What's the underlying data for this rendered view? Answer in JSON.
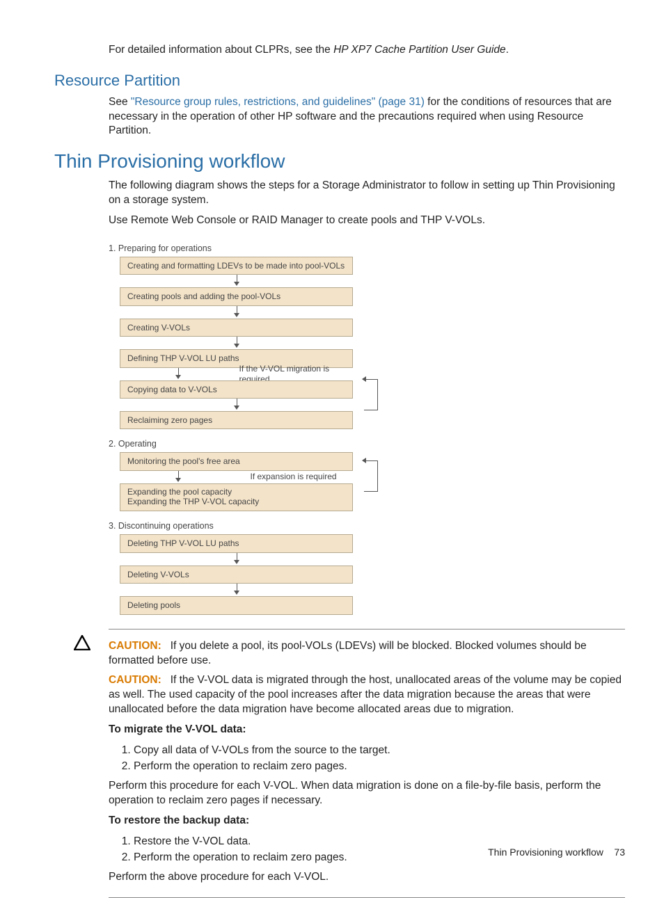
{
  "intro_para": {
    "pre": "For detailed information about CLPRs, see the ",
    "italic": "HP XP7 Cache Partition User Guide",
    "post": "."
  },
  "h_resource": "Resource Partition",
  "resource_para": {
    "pre": "See ",
    "link": "\"Resource group rules, restrictions, and guidelines\" (page 31)",
    "post": " for the conditions of resources that are necessary in the operation of other HP software and the precautions required when using Resource Partition."
  },
  "h_workflow": "Thin Provisioning workflow",
  "workflow_p1": "The following diagram shows the steps for a Storage Administrator to follow in setting up Thin Provisioning on a storage system.",
  "workflow_p2": "Use Remote Web Console or RAID Manager to create pools and THP V-VOLs.",
  "diagram": {
    "s1_title": "1. Preparing for operations",
    "s1_boxes": [
      "Creating and formatting LDEVs to be made into pool-VOLs",
      "Creating pools and adding the pool-VOLs",
      "Creating V-VOLs",
      "Defining THP V-VOL LU paths",
      "Copying data to V-VOLs",
      "Reclaiming zero pages"
    ],
    "s1_side1": "If the V-VOL migration is required",
    "s2_title": "2. Operating",
    "s2_boxes": [
      "Monitoring the pool's free area",
      "Expanding the pool capacity\nExpanding the THP V-VOL capacity"
    ],
    "s2_side1": "If expansion is required",
    "s3_title": "3. Discontinuing operations",
    "s3_boxes": [
      "Deleting THP V-VOL LU paths",
      "Deleting V-VOLs",
      "Deleting pools"
    ]
  },
  "caution_label": "CAUTION:",
  "caution1": "If you delete a pool, its pool-VOLs (LDEVs) will be blocked. Blocked volumes should be formatted before use.",
  "caution2": "If the V-VOL data is migrated through the host, unallocated areas of the volume may be copied as well. The used capacity of the pool increases after the data migration because the areas that were unallocated before the data migration have become allocated areas due to migration.",
  "migrate_h": "To migrate the V-VOL data:",
  "migrate_steps": [
    "Copy all data of V-VOLs from the source to the target.",
    "Perform the operation to reclaim zero pages."
  ],
  "migrate_after": "Perform this procedure for each V-VOL. When data migration is done on a file-by-file basis, perform the operation to reclaim zero pages if necessary.",
  "restore_h": "To restore the backup data:",
  "restore_steps": [
    "Restore the V-VOL data.",
    "Perform the operation to reclaim zero pages."
  ],
  "restore_after": "Perform the above procedure for each V-VOL.",
  "footer": {
    "text": "Thin Provisioning workflow",
    "page": "73"
  }
}
